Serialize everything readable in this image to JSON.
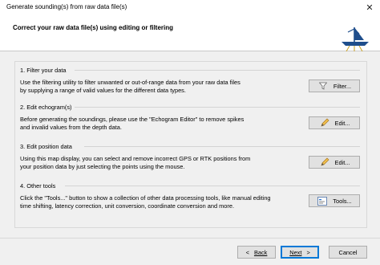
{
  "window": {
    "title": "Generate sounding(s) from raw data file(s)",
    "close_glyph": "✕"
  },
  "header": {
    "heading": "Correct your raw data file(s) using editing or filtering"
  },
  "sections": [
    {
      "title": "1. Filter your data",
      "line1": "Use the filtering utility to filter unwanted or out-of-range data from your raw data files",
      "line2": "by supplying a range of valid values for the different data types.",
      "button_label": "Filter...",
      "icon": "funnel-icon"
    },
    {
      "title": "2. Edit echogram(s)",
      "line1": "Before generating the soundings, please use the \"Echogram Editor\" to remove spikes",
      "line2": "and invalid values from the depth data.",
      "button_label": "Edit...",
      "icon": "pencil-icon"
    },
    {
      "title": "3. Edit position data",
      "line1": "Using this map display, you can select and remove incorrect GPS or RTK positions from",
      "line2": "your position data by just selecting the points using the mouse.",
      "button_label": "Edit...",
      "icon": "pencil-icon"
    },
    {
      "title": "4. Other tools",
      "line1": "Click the \"Tools...\" button to show a collection of other data processing tools, like manual editing",
      "line2": "time shifting, latency correction, unit conversion, coordinate conversion and more.",
      "button_label": "Tools...",
      "icon": "toolbox-icon"
    }
  ],
  "footer": {
    "back_arrow": "<",
    "back_label": "Back",
    "next_label": "Next",
    "next_arrow": ">",
    "cancel_label": "Cancel"
  },
  "colors": {
    "accent": "#0078d7",
    "button_face": "#e1e1e1",
    "body_bg": "#f0f0f0",
    "logo_blue": "#1f4e8c"
  }
}
